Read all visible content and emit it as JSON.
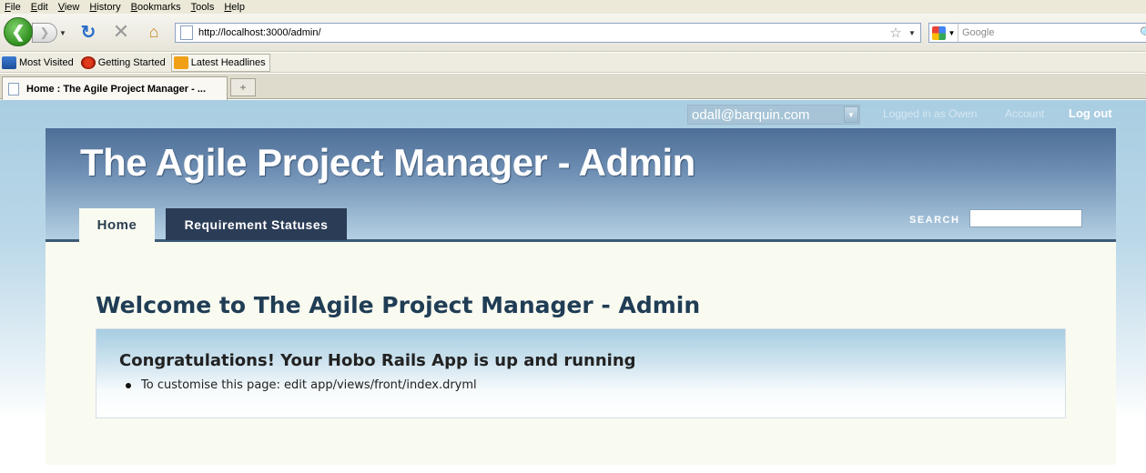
{
  "browser": {
    "menu": [
      "File",
      "Edit",
      "View",
      "History",
      "Bookmarks",
      "Tools",
      "Help"
    ],
    "url": "http://localhost:3000/admin/",
    "search_placeholder": "Google",
    "bookmarks": [
      "Most Visited",
      "Getting Started",
      "Latest Headlines"
    ],
    "tab_title": "Home : The Agile Project Manager - ...",
    "new_tab": "+"
  },
  "account": {
    "selected_user": "odall@barquin.com",
    "logged_in_text": "Logged in as Owen",
    "account_link": "Account",
    "logout_link": "Log out"
  },
  "header": {
    "app_name": "The Agile Project Manager - Admin",
    "tabs": [
      "Home",
      "Requirement Statuses"
    ],
    "search_label": "SEARCH"
  },
  "main": {
    "heading": "Welcome to The Agile Project Manager - Admin",
    "panel_title": "Congratulations! Your Hobo Rails App is up and running",
    "panel_item": "To customise this page: edit app/views/front/index.dryml"
  }
}
